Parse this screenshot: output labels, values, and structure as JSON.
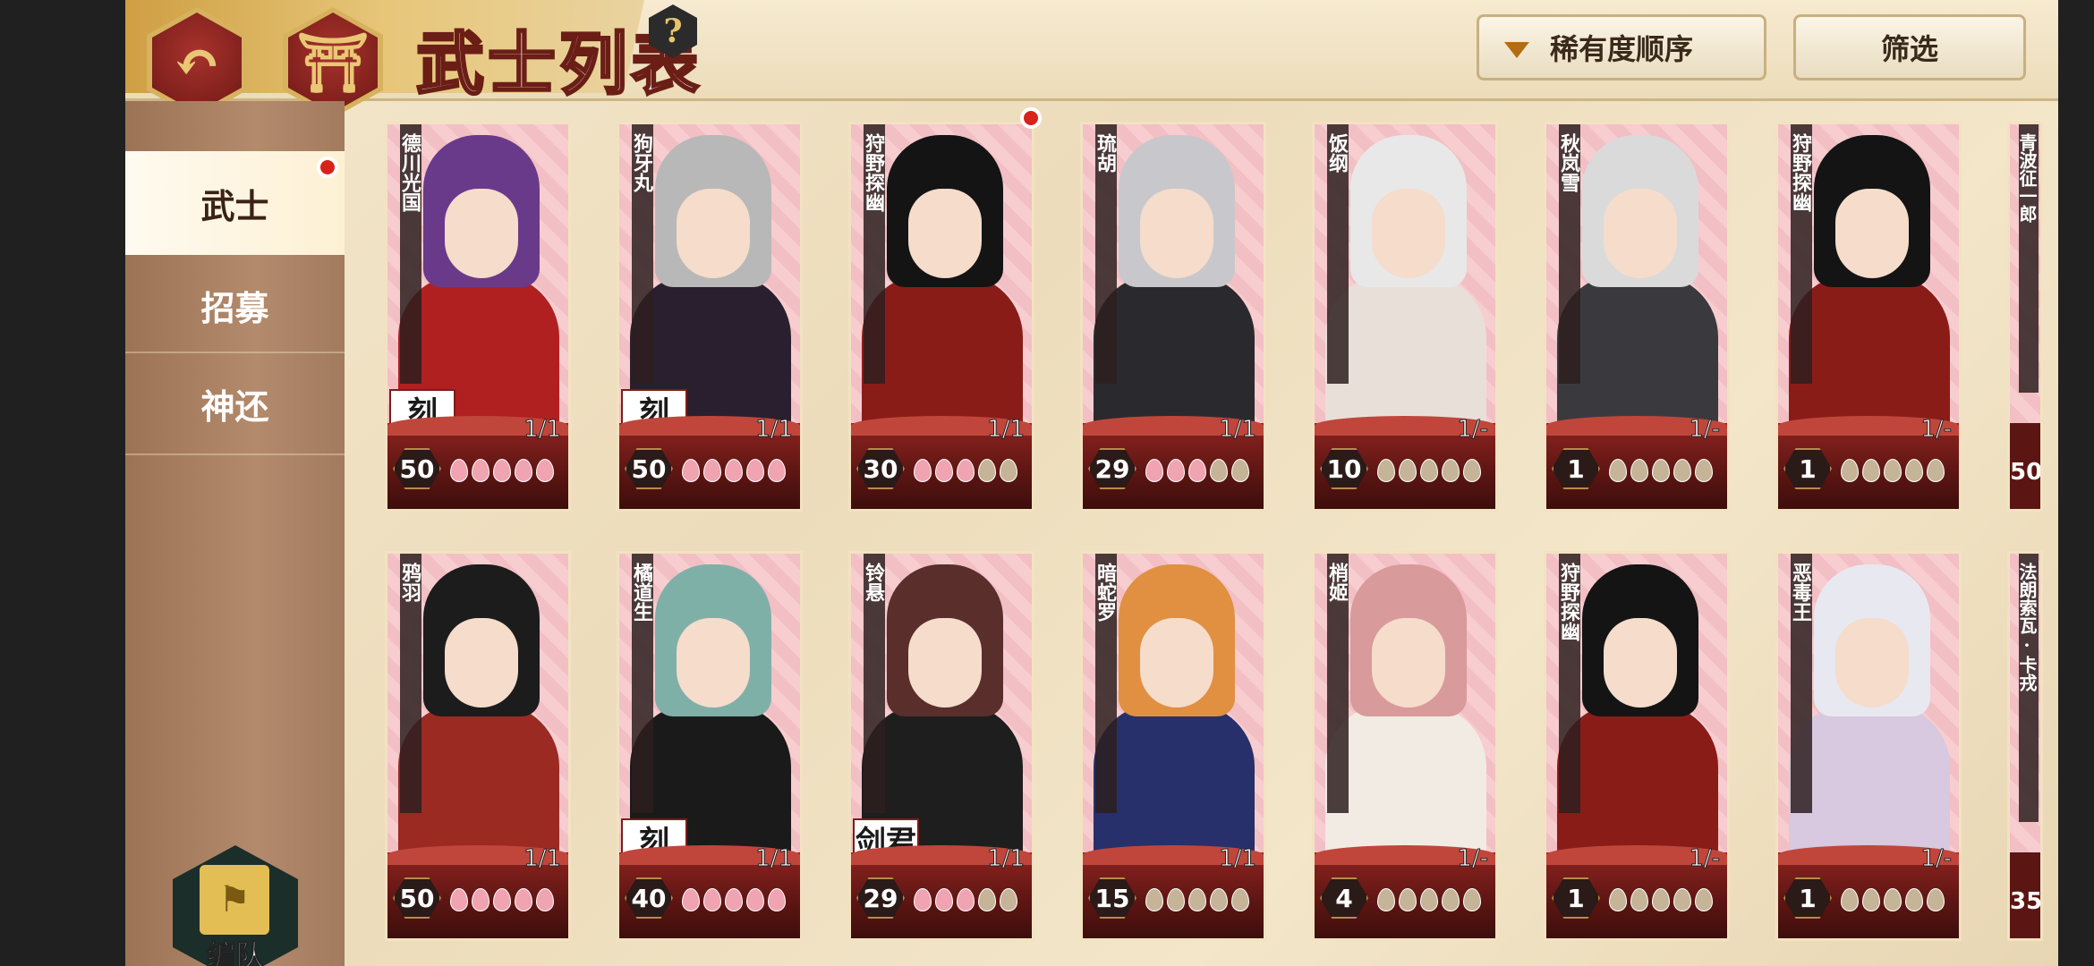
{
  "header": {
    "title": "武士列表",
    "help_glyph": "?",
    "back_glyph": "↶",
    "home_glyph": "⛩",
    "sort_label": "稀有度顺序",
    "filter_label": "筛选"
  },
  "sidebar": {
    "tabs": [
      {
        "label": "武士",
        "active": true
      },
      {
        "label": "招募",
        "active": false
      },
      {
        "label": "神还",
        "active": false
      }
    ],
    "formation_label": "编队"
  },
  "cards": [
    {
      "name": "德川光国",
      "level": "50",
      "count": "1/1",
      "badge": "刻",
      "petals_on": 5,
      "hair": "#6a3a8a",
      "body": "#b02020"
    },
    {
      "name": "狗牙丸",
      "level": "50",
      "count": "1/1",
      "badge": "刻",
      "petals_on": 5,
      "hair": "#b8b8b8",
      "body": "#2a1f2e"
    },
    {
      "name": "狩野探幽",
      "level": "30",
      "count": "1/1",
      "badge": "",
      "petals_on": 3,
      "hair": "#141414",
      "body": "#8a1c18"
    },
    {
      "name": "琉胡",
      "level": "29",
      "count": "1/1",
      "badge": "",
      "petals_on": 3,
      "hair": "#c8c8cc",
      "body": "#2a2a2e"
    },
    {
      "name": "饭纲",
      "level": "10",
      "count": "1/-",
      "badge": "",
      "petals_on": 0,
      "hair": "#e8e8e8",
      "body": "#e8e0d8"
    },
    {
      "name": "秋岚雪",
      "level": "1",
      "count": "1/-",
      "badge": "",
      "petals_on": 0,
      "hair": "#dadada",
      "body": "#3a3a3e"
    },
    {
      "name": "狩野探幽",
      "level": "1",
      "count": "1/-",
      "badge": "",
      "petals_on": 0,
      "hair": "#141414",
      "body": "#8a1c18"
    },
    {
      "name": "鸦羽",
      "level": "50",
      "count": "1/1",
      "badge": "",
      "petals_on": 5,
      "hair": "#1c1c1c",
      "body": "#9a2a22"
    },
    {
      "name": "橘道生",
      "level": "40",
      "count": "1/1",
      "badge": "刻",
      "petals_on": 5,
      "hair": "#7fb0a8",
      "body": "#1a1a1a"
    },
    {
      "name": "铃悬",
      "level": "29",
      "count": "1/1",
      "badge": "剑君",
      "petals_on": 3,
      "hair": "#5a2e2a",
      "body": "#1e1e1e"
    },
    {
      "name": "暗蛇罗",
      "level": "15",
      "count": "1/1",
      "badge": "",
      "petals_on": 0,
      "hair": "#e09040",
      "body": "#27306a"
    },
    {
      "name": "梢姬",
      "level": "4",
      "count": "1/-",
      "badge": "",
      "petals_on": 0,
      "hair": "#d89a9a",
      "body": "#f2ebe4"
    },
    {
      "name": "狩野探幽",
      "level": "1",
      "count": "1/-",
      "badge": "",
      "petals_on": 0,
      "hair": "#141414",
      "body": "#8a1c18"
    },
    {
      "name": "恶毒王",
      "level": "1",
      "count": "1/-",
      "badge": "",
      "petals_on": 0,
      "hair": "#e8e8f0",
      "body": "#d8c8e0"
    }
  ],
  "edge_cards": [
    {
      "name": "青波征一郎",
      "level": "50"
    },
    {
      "name": "法朗索瓦·卡戎",
      "level": "35"
    }
  ]
}
